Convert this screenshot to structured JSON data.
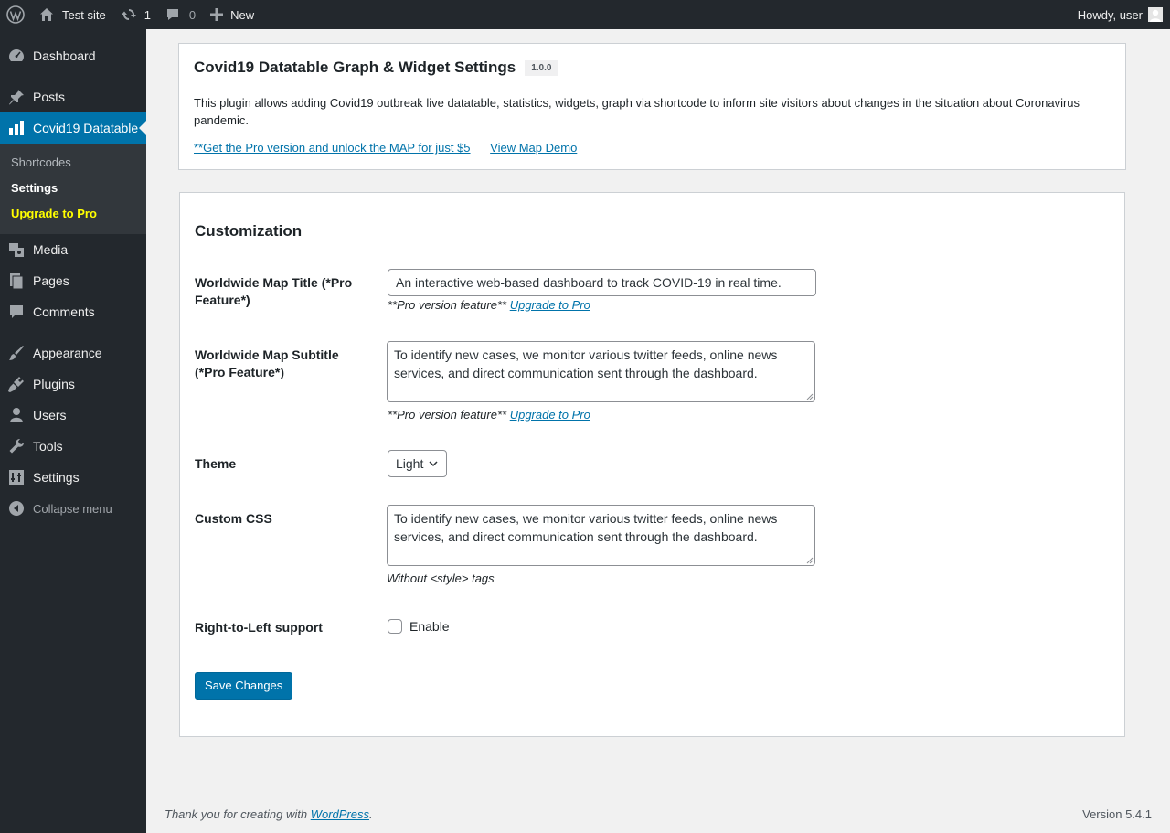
{
  "adminbar": {
    "site_name": "Test site",
    "updates_count": "1",
    "comments_count": "0",
    "new_label": "New",
    "howdy": "Howdy, user"
  },
  "menu": {
    "dashboard": "Dashboard",
    "posts": "Posts",
    "covid": "Covid19 Datatable",
    "submenu": {
      "shortcodes": "Shortcodes",
      "settings": "Settings",
      "upgrade": "Upgrade to Pro"
    },
    "media": "Media",
    "pages": "Pages",
    "comments": "Comments",
    "appearance": "Appearance",
    "plugins": "Plugins",
    "users": "Users",
    "tools": "Tools",
    "settings": "Settings",
    "collapse": "Collapse menu"
  },
  "header": {
    "title": "Covid19 Datatable Graph & Widget Settings",
    "version": "1.0.0",
    "description": "This plugin allows adding Covid19 outbreak live datatable, statistics, widgets, graph via shortcode to inform site visitors about changes in the situation about Coronavirus pandemic.",
    "pro_link": "**Get the Pro version and unlock the MAP for just $5",
    "demo_link": "View Map Demo"
  },
  "settings": {
    "section_title": "Customization",
    "map_title_label": "Worldwide Map Title (*Pro Feature*)",
    "map_title_value": "An interactive web-based dashboard to track COVID-19 in real time.",
    "map_title_note": "**Pro version feature**",
    "upgrade_link": "Upgrade to Pro",
    "map_subtitle_label": "Worldwide Map Subtitle (*Pro Feature*)",
    "map_subtitle_value": "To identify new cases, we monitor various twitter feeds, online news services, and direct communication sent through the dashboard.",
    "map_subtitle_note": "**Pro version feature**",
    "theme_label": "Theme",
    "theme_value": "Light",
    "css_label": "Custom CSS",
    "css_value": "To identify new cases, we monitor various twitter feeds, online news services, and direct communication sent through the dashboard.",
    "css_note": "Without <style> tags",
    "rtl_label": "Right-to-Left support",
    "rtl_checkbox_label": "Enable",
    "rtl_checked": false,
    "save_label": "Save Changes"
  },
  "footer": {
    "thanks_prefix": "Thank you for creating with",
    "wordpress_link": "WordPress",
    "thanks_suffix": ".",
    "version": "Version 5.4.1"
  },
  "colors": {
    "accent": "#0073aa",
    "sidebar_bg": "#23282d",
    "submenu_bg": "#32373c",
    "upgrade_text": "#ffff00"
  }
}
